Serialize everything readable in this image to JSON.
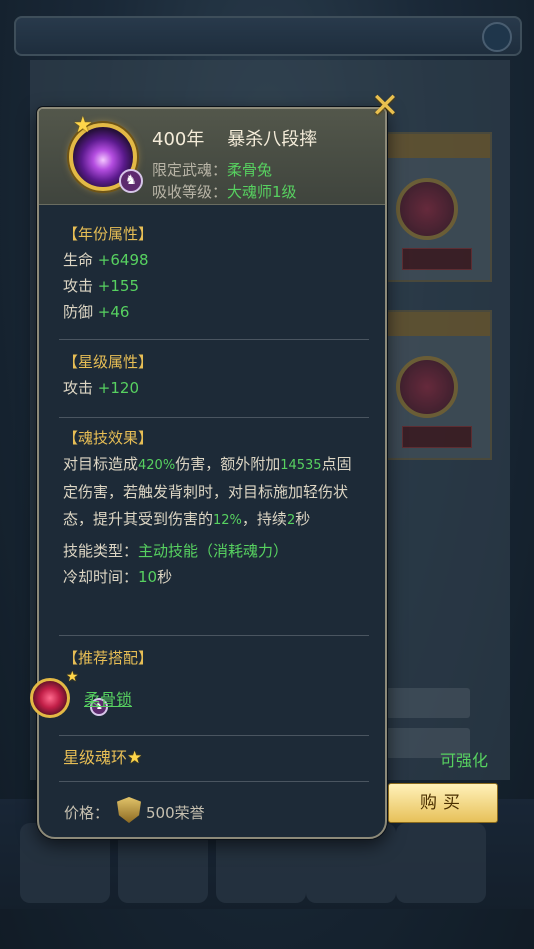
{
  "tooltip": {
    "title": "400年    暴杀八段摔",
    "weapon_label": "限定武魂：",
    "weapon_value": "柔骨兔",
    "level_label": "吸收等级：",
    "level_value": "大魂师1级",
    "year_attr": {
      "title": "【年份属性】",
      "rows": [
        {
          "name": "生命",
          "value": "+6498"
        },
        {
          "name": "攻击",
          "value": "+155"
        },
        {
          "name": "防御",
          "value": "+46"
        }
      ]
    },
    "star_attr": {
      "title": "【星级属性】",
      "rows": [
        {
          "name": "攻击",
          "value": "+120"
        }
      ]
    },
    "skill": {
      "title": "【魂技效果】",
      "d1": "对目标造成",
      "d2": "420%",
      "d3": "伤害，额外附加",
      "d4": "14535",
      "d5": "点固定伤害，若触发背刺时，对目标施加轻伤状态，提升其受到伤害的",
      "d6": "12%",
      "d7": "，持续",
      "d8": "2",
      "d9": "秒",
      "type_label": "技能类型：",
      "type_value": "主动技能（消耗魂力）",
      "cd_label": "冷却时间：",
      "cd_value": "10",
      "cd_unit": "秒"
    },
    "recommend": {
      "title": "【推荐搭配】",
      "item": "柔骨锁"
    },
    "star_ring": {
      "label": "星级魂环",
      "status": "可强化"
    },
    "price": {
      "label": "价格：",
      "value": "500荣誉"
    }
  },
  "buttons": {
    "close": "✕",
    "buy": "购买"
  },
  "icons": {
    "skill": "purple-skill-icon",
    "star": "star-icon",
    "rabbit": "rabbit-badge-icon",
    "honor": "honor-shield-icon"
  },
  "colors": {
    "gold": "#e7be55",
    "green": "#57d160",
    "panel_bg": "#1d2a37"
  }
}
